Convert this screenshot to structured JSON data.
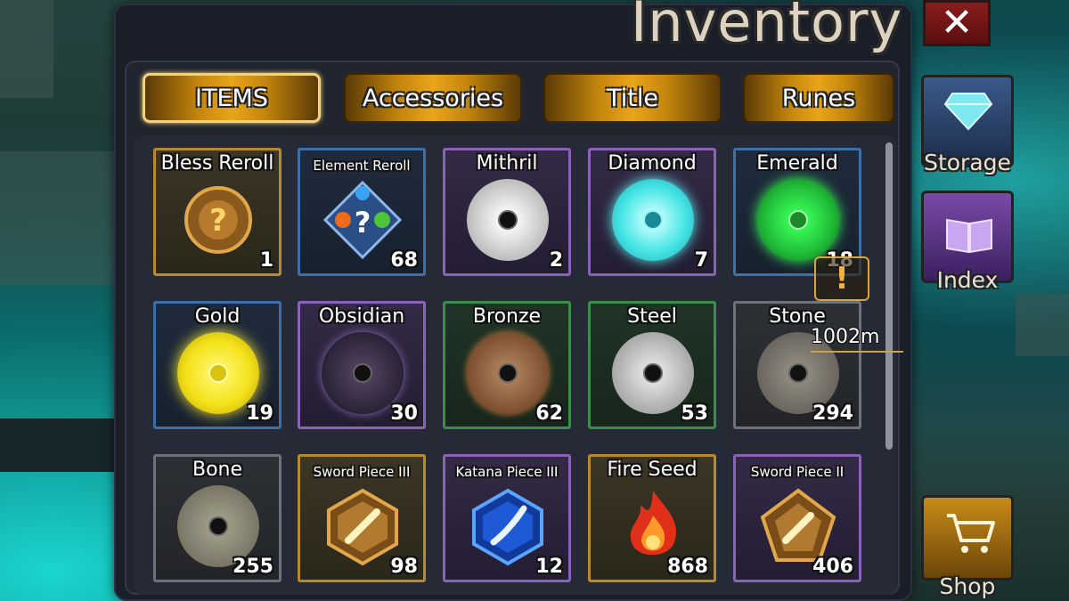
{
  "title": "Inventory",
  "close_icon": "✕",
  "tabs": [
    {
      "label": "ITEMS",
      "active": true
    },
    {
      "label": "Accessories",
      "active": false
    },
    {
      "label": "Title",
      "active": false
    },
    {
      "label": "Runes",
      "active": false
    }
  ],
  "items": [
    {
      "name": "Bless Reroll",
      "count": "1",
      "rarity": "gold",
      "icon": "bless-reroll-icon"
    },
    {
      "name": "Element Reroll",
      "count": "68",
      "rarity": "blue",
      "icon": "element-reroll-icon"
    },
    {
      "name": "Mithril",
      "count": "2",
      "rarity": "purple",
      "icon": "mithril-disc-icon",
      "color": "#d8d8d8"
    },
    {
      "name": "Diamond",
      "count": "7",
      "rarity": "purple",
      "icon": "diamond-disc-icon",
      "color": "#48e6e6"
    },
    {
      "name": "Emerald",
      "count": "18",
      "rarity": "blue",
      "icon": "emerald-disc-icon",
      "color": "#22c23a"
    },
    {
      "name": "Gold",
      "count": "19",
      "rarity": "blue",
      "icon": "gold-disc-icon",
      "color": "#f4e21a"
    },
    {
      "name": "Obsidian",
      "count": "30",
      "rarity": "purple",
      "icon": "obsidian-disc-icon",
      "color": "#3a2f45"
    },
    {
      "name": "Bronze",
      "count": "62",
      "rarity": "green",
      "icon": "bronze-disc-icon",
      "color": "#8a5a36"
    },
    {
      "name": "Steel",
      "count": "53",
      "rarity": "green",
      "icon": "steel-disc-icon",
      "color": "#b8b8b8"
    },
    {
      "name": "Stone",
      "count": "294",
      "rarity": "gray",
      "icon": "stone-disc-icon",
      "color": "#7f7a70"
    },
    {
      "name": "Bone",
      "count": "255",
      "rarity": "gray",
      "icon": "bone-disc-icon",
      "color": "#8c8878"
    },
    {
      "name": "Sword Piece III",
      "count": "98",
      "rarity": "gold",
      "icon": "sword-piece-icon"
    },
    {
      "name": "Katana Piece III",
      "count": "12",
      "rarity": "purple",
      "icon": "katana-piece-icon"
    },
    {
      "name": "Fire Seed",
      "count": "868",
      "rarity": "gold",
      "icon": "fire-seed-icon"
    },
    {
      "name": "Sword Piece II",
      "count": "406",
      "rarity": "purple",
      "icon": "sword-piece-icon"
    }
  ],
  "side_buttons": [
    {
      "label": "Storage",
      "icon": "diamond-icon"
    },
    {
      "label": "Index",
      "icon": "book-icon"
    },
    {
      "label": "Shop",
      "icon": "cart-icon"
    }
  ],
  "alert_icon": "!",
  "distance": "1002m"
}
